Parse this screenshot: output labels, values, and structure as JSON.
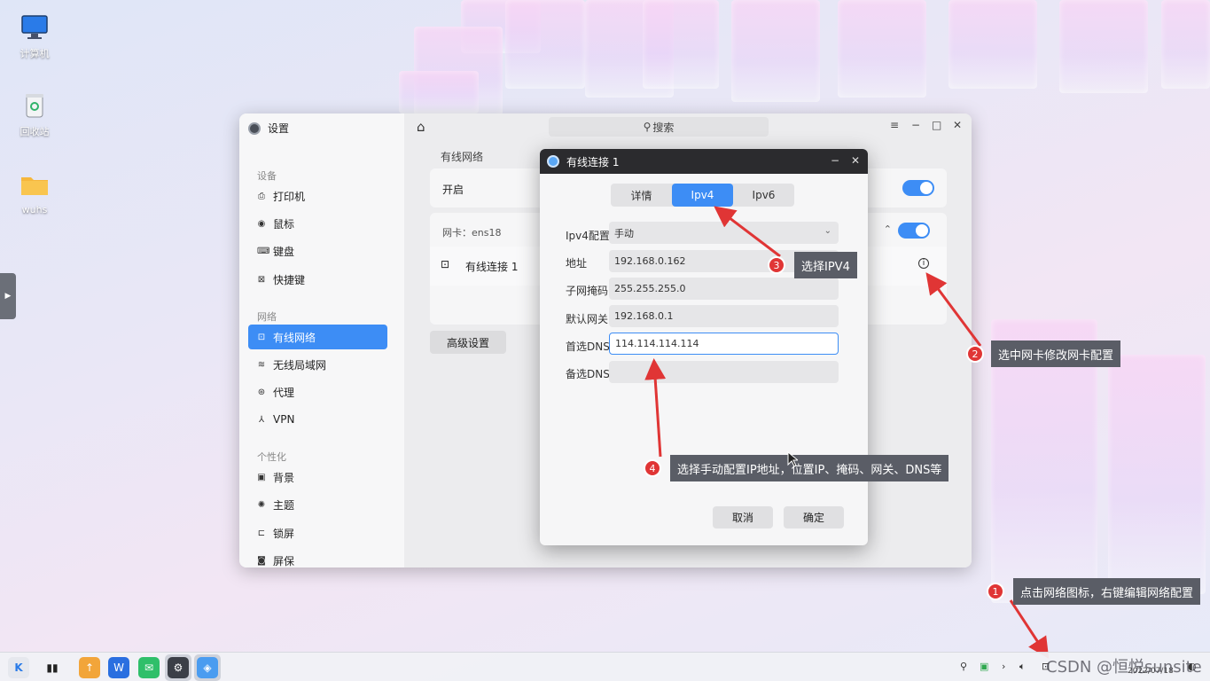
{
  "desktop": {
    "icons": [
      {
        "label": "计算机",
        "icon": "computer-icon"
      },
      {
        "label": "回收站",
        "icon": "trash-icon"
      },
      {
        "label": "wuhs",
        "icon": "folder-icon"
      }
    ]
  },
  "settings": {
    "title": "设置",
    "search_placeholder": "搜索",
    "sidebar": {
      "groups": [
        {
          "label": "设备",
          "items": [
            {
              "label": "打印机",
              "icon": "printer-icon"
            },
            {
              "label": "鼠标",
              "icon": "mouse-icon"
            },
            {
              "label": "键盘",
              "icon": "keyboard-icon"
            },
            {
              "label": "快捷键",
              "icon": "shortcut-icon"
            }
          ]
        },
        {
          "label": "网络",
          "items": [
            {
              "label": "有线网络",
              "icon": "wired-network-icon",
              "active": true
            },
            {
              "label": "无线局域网",
              "icon": "wifi-icon"
            },
            {
              "label": "代理",
              "icon": "proxy-icon"
            },
            {
              "label": "VPN",
              "icon": "vpn-icon"
            }
          ]
        },
        {
          "label": "个性化",
          "items": [
            {
              "label": "背景",
              "icon": "background-icon"
            },
            {
              "label": "主题",
              "icon": "theme-icon"
            },
            {
              "label": "锁屏",
              "icon": "lockscreen-icon"
            },
            {
              "label": "屏保",
              "icon": "screensaver-icon"
            }
          ]
        }
      ]
    },
    "main": {
      "section_title": "有线网络",
      "enable_label": "开启",
      "enable_on": true,
      "nic_label": "网卡：ens18",
      "nic_on": true,
      "connection_label": "有线连接 1",
      "advanced_button": "高级设置"
    }
  },
  "dialog": {
    "title": "有线连接 1",
    "tabs": [
      {
        "label": "详情",
        "active": false
      },
      {
        "label": "Ipv4",
        "active": true
      },
      {
        "label": "Ipv6",
        "active": false
      }
    ],
    "fields": {
      "config_label": "Ipv4配置",
      "config_value": "手动",
      "address_label": "地址",
      "address_value": "192.168.0.162",
      "mask_label": "子网掩码",
      "mask_value": "255.255.255.0",
      "gateway_label": "默认网关",
      "gateway_value": "192.168.0.1",
      "dns1_label": "首选DNS",
      "dns1_value": "114.114.114.114",
      "dns2_label": "备选DNS",
      "dns2_value": ""
    },
    "cancel_button": "取消",
    "ok_button": "确定"
  },
  "annotations": [
    {
      "num": "1",
      "text": "点击网络图标，右键编辑网络配置"
    },
    {
      "num": "2",
      "text": "选中网卡修改网卡配置"
    },
    {
      "num": "3",
      "text": "选择IPV4"
    },
    {
      "num": "4",
      "text": "选择手动配置IP地址，位置IP、掩码、网关、DNS等"
    }
  ],
  "taskbar": {
    "watermark": "CSDN @恒悦sunsite",
    "date": "2022/07/18"
  },
  "colors": {
    "accent": "#3d8df5",
    "callout": "#5a5d66",
    "marker": "#e03535"
  }
}
